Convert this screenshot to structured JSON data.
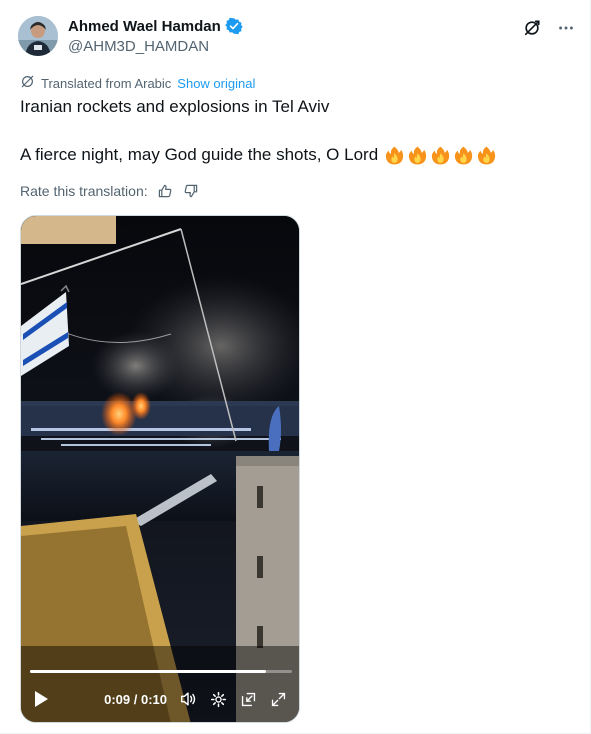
{
  "author": {
    "display_name": "Ahmed Wael Hamdan",
    "handle": "@AHM3D_HAMDAN",
    "verified": true
  },
  "header_actions": {
    "icons": [
      "grok-icon",
      "more-icon"
    ]
  },
  "translation": {
    "label": "Translated from Arabic",
    "show_original": "Show original"
  },
  "tweet": {
    "line1": "Iranian rockets and explosions in Tel Aviv",
    "line2": "A fierce night, may God guide the shots, O Lord",
    "emoji_count": 5
  },
  "rate": {
    "label": "Rate this translation:"
  },
  "video": {
    "current_time": "0:09",
    "duration": "0:10",
    "time_display": "0:09 / 0:10",
    "progress": 0.9
  },
  "colors": {
    "accent": "#1d9bf0",
    "text": "#0f1419",
    "muted": "#536471"
  }
}
